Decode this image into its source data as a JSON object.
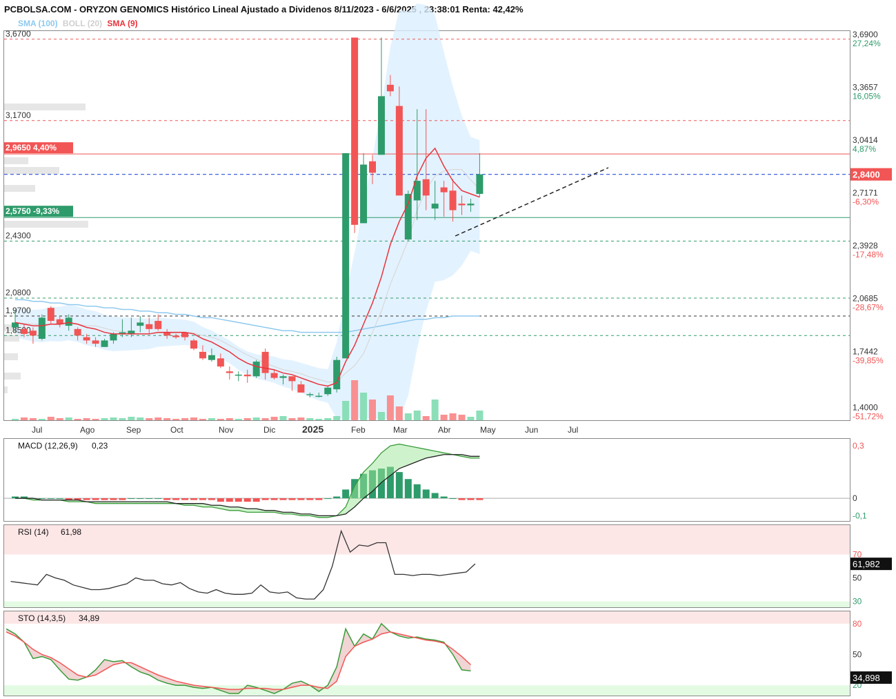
{
  "header": {
    "title": "PCBOLSA.COM - ORYZON GENOMICS Histórico Lineal Ajustado a Dividenos 8/11/2023 - 6/6/2025 , 23:38:01 Renta: 42,42%"
  },
  "legend": {
    "sma100": "SMA (100)",
    "boll": "BOLL (20)",
    "sma9": "SMA (9)"
  },
  "colors": {
    "up": "#2e9b6b",
    "down": "#f25555",
    "sma9": "#e8333b",
    "sma100": "#8ec9ef",
    "boll_fill": "#dcefff",
    "grid": "#888888"
  },
  "price_levels_left": [
    {
      "value": "3,6700",
      "color": "#f25555",
      "dash": true
    },
    {
      "value": "3,1700",
      "color": "#f25555",
      "dash": true
    },
    {
      "value": "2,9650",
      "badge": "2,9650  4,40%",
      "color": "#f25555",
      "dash": false
    },
    {
      "value": "2,5750",
      "badge": "2,5750  -9,33%",
      "color": "#2e9b6b",
      "dash": false
    },
    {
      "value": "2,4300",
      "color": "#2e9b6b",
      "dash": true
    },
    {
      "value": "2,0800",
      "color": "#2e9b6b",
      "dash": true
    },
    {
      "value": "1,9700",
      "color": "#333333",
      "dash": true
    },
    {
      "value": "1,8500",
      "color": "#2e9b6b",
      "dash": true
    }
  ],
  "price_axis_right": [
    {
      "value": "3,6900",
      "pct": "27,24%",
      "pct_color": "#2e9b6b"
    },
    {
      "value": "3,3657",
      "pct": "16,05%",
      "pct_color": "#2e9b6b"
    },
    {
      "value": "3,0414",
      "pct": "4,87%",
      "pct_color": "#2e9b6b"
    },
    {
      "value": "2,7171",
      "pct": "-6,30%",
      "pct_color": "#f25555"
    },
    {
      "value": "2,3928",
      "pct": "-17,48%",
      "pct_color": "#f25555"
    },
    {
      "value": "2,0685",
      "pct": "-28,67%",
      "pct_color": "#f25555"
    },
    {
      "value": "1,7442",
      "pct": "-39,85%",
      "pct_color": "#f25555"
    },
    {
      "value": "1,4000",
      "pct": "-51,72%",
      "pct_color": "#f25555"
    }
  ],
  "last_price": "2,8400",
  "x_labels": [
    "Jul",
    "Ago",
    "Sep",
    "Oct",
    "Nov",
    "Dic",
    "2025",
    "Feb",
    "Mar",
    "Abr",
    "May",
    "Jun",
    "Jul"
  ],
  "chart_data": [
    {
      "type": "candlestick",
      "title": "ORYZON GENOMICS",
      "ylim": [
        1.33,
        3.72
      ],
      "ohlc": [
        [
          1.9,
          2.01,
          1.87,
          1.93
        ],
        [
          1.89,
          1.92,
          1.84,
          1.86
        ],
        [
          1.88,
          1.9,
          1.8,
          1.85
        ],
        [
          1.83,
          1.98,
          1.82,
          1.96
        ],
        [
          2.02,
          2.03,
          1.92,
          1.94
        ],
        [
          1.95,
          1.97,
          1.9,
          1.92
        ],
        [
          1.91,
          1.98,
          1.88,
          1.96
        ],
        [
          1.89,
          1.9,
          1.82,
          1.85
        ],
        [
          1.84,
          1.86,
          1.8,
          1.82
        ],
        [
          1.82,
          1.84,
          1.78,
          1.8
        ],
        [
          1.78,
          1.83,
          1.78,
          1.82
        ],
        [
          1.82,
          1.87,
          1.8,
          1.86
        ],
        [
          1.86,
          1.95,
          1.84,
          1.87
        ],
        [
          1.86,
          1.96,
          1.84,
          1.88
        ],
        [
          1.91,
          1.97,
          1.87,
          1.93
        ],
        [
          1.92,
          1.96,
          1.86,
          1.89
        ],
        [
          1.94,
          1.98,
          1.88,
          1.89
        ],
        [
          1.87,
          1.89,
          1.83,
          1.85
        ],
        [
          1.85,
          1.86,
          1.83,
          1.84
        ],
        [
          1.87,
          1.87,
          1.82,
          1.84
        ],
        [
          1.82,
          1.83,
          1.76,
          1.77
        ],
        [
          1.75,
          1.79,
          1.7,
          1.71
        ],
        [
          1.7,
          1.77,
          1.69,
          1.73
        ],
        [
          1.71,
          1.74,
          1.65,
          1.66
        ],
        [
          1.63,
          1.66,
          1.58,
          1.62
        ],
        [
          1.61,
          1.63,
          1.57,
          1.61
        ],
        [
          1.61,
          1.64,
          1.56,
          1.6
        ],
        [
          1.6,
          1.7,
          1.59,
          1.69
        ],
        [
          1.75,
          1.77,
          1.58,
          1.62
        ],
        [
          1.62,
          1.64,
          1.58,
          1.59
        ],
        [
          1.59,
          1.61,
          1.55,
          1.6
        ],
        [
          1.6,
          1.6,
          1.51,
          1.57
        ],
        [
          1.55,
          1.57,
          1.5,
          1.5
        ],
        [
          1.49,
          1.5,
          1.47,
          1.49
        ],
        [
          1.48,
          1.5,
          1.47,
          1.48
        ],
        [
          1.49,
          1.54,
          1.48,
          1.53
        ],
        [
          1.52,
          1.72,
          1.5,
          1.7
        ],
        [
          1.71,
          2.97,
          1.71,
          2.97
        ],
        [
          3.68,
          3.68,
          2.48,
          2.53
        ],
        [
          2.54,
          2.97,
          2.54,
          2.9
        ],
        [
          2.92,
          2.96,
          2.78,
          2.85
        ],
        [
          2.96,
          3.68,
          2.96,
          3.32
        ],
        [
          3.39,
          3.45,
          3.32,
          3.35
        ],
        [
          3.26,
          3.38,
          2.73,
          2.71
        ],
        [
          2.44,
          2.74,
          2.43,
          2.72
        ],
        [
          2.68,
          3.24,
          2.56,
          2.8
        ],
        [
          2.81,
          3.24,
          2.62,
          2.71
        ],
        [
          2.63,
          2.8,
          2.56,
          2.66
        ],
        [
          2.76,
          2.8,
          2.58,
          2.73
        ],
        [
          2.74,
          2.81,
          2.55,
          2.62
        ],
        [
          2.66,
          2.71,
          2.59,
          2.65
        ],
        [
          2.65,
          2.69,
          2.61,
          2.66
        ],
        [
          2.72,
          2.97,
          2.7,
          2.84
        ]
      ],
      "volume": [
        2,
        4,
        3,
        2,
        5,
        3,
        4,
        2,
        3,
        2,
        3,
        4,
        3,
        5,
        4,
        3,
        4,
        3,
        2,
        3,
        4,
        2,
        3,
        2,
        3,
        2,
        3,
        4,
        3,
        5,
        6,
        3,
        4,
        3,
        2,
        3,
        6,
        28,
        58,
        40,
        30,
        12,
        36,
        20,
        10,
        14,
        6,
        30,
        8,
        10,
        8,
        5,
        14
      ],
      "sma9": [
        1.93,
        1.92,
        1.91,
        1.91,
        1.92,
        1.92,
        1.93,
        1.92,
        1.9,
        1.89,
        1.87,
        1.86,
        1.86,
        1.86,
        1.86,
        1.86,
        1.87,
        1.87,
        1.87,
        1.87,
        1.86,
        1.83,
        1.81,
        1.78,
        1.75,
        1.71,
        1.68,
        1.66,
        1.65,
        1.64,
        1.62,
        1.61,
        1.59,
        1.57,
        1.55,
        1.54,
        1.56,
        1.69,
        1.79,
        1.92,
        2.05,
        2.21,
        2.41,
        2.55,
        2.66,
        2.83,
        2.94,
        3.0,
        2.89,
        2.8,
        2.74,
        2.72,
        2.7
      ],
      "sma100": [
        2.07,
        2.07,
        2.06,
        2.06,
        2.05,
        2.05,
        2.04,
        2.04,
        2.03,
        2.03,
        2.02,
        2.02,
        2.01,
        2.01,
        2.0,
        2.0,
        1.99,
        1.99,
        1.98,
        1.98,
        1.97,
        1.96,
        1.96,
        1.95,
        1.94,
        1.93,
        1.92,
        1.91,
        1.9,
        1.89,
        1.88,
        1.88,
        1.87,
        1.87,
        1.87,
        1.87,
        1.87,
        1.87,
        1.88,
        1.89,
        1.9,
        1.91,
        1.92,
        1.93,
        1.94,
        1.95,
        1.95,
        1.96,
        1.96,
        1.97,
        1.97,
        1.97,
        1.97
      ]
    },
    {
      "type": "line",
      "title": "MACD (12,26,9)",
      "value_label": "0,23",
      "ylim": [
        -0.13,
        0.34
      ],
      "y_ticks": [
        "0,3",
        "0",
        "-0,1"
      ],
      "macd": [
        0,
        0,
        -0.01,
        -0.01,
        -0.01,
        -0.01,
        -0.02,
        -0.02,
        -0.02,
        -0.03,
        -0.03,
        -0.03,
        -0.03,
        -0.03,
        -0.03,
        -0.03,
        -0.03,
        -0.03,
        -0.03,
        -0.04,
        -0.04,
        -0.05,
        -0.05,
        -0.06,
        -0.07,
        -0.07,
        -0.08,
        -0.08,
        -0.08,
        -0.08,
        -0.09,
        -0.09,
        -0.1,
        -0.1,
        -0.11,
        -0.11,
        -0.1,
        -0.05,
        0.07,
        0.15,
        0.2,
        0.26,
        0.3,
        0.31,
        0.3,
        0.29,
        0.28,
        0.27,
        0.26,
        0.25,
        0.24,
        0.23,
        0.23
      ],
      "signal": [
        0,
        0,
        0,
        -0.01,
        -0.01,
        -0.01,
        -0.01,
        -0.01,
        -0.02,
        -0.02,
        -0.02,
        -0.02,
        -0.02,
        -0.02,
        -0.02,
        -0.02,
        -0.02,
        -0.02,
        -0.03,
        -0.03,
        -0.03,
        -0.03,
        -0.04,
        -0.04,
        -0.05,
        -0.05,
        -0.06,
        -0.06,
        -0.07,
        -0.07,
        -0.08,
        -0.08,
        -0.09,
        -0.09,
        -0.1,
        -0.1,
        -0.1,
        -0.09,
        -0.05,
        0.0,
        0.04,
        0.09,
        0.13,
        0.17,
        0.19,
        0.21,
        0.23,
        0.24,
        0.25,
        0.25,
        0.25,
        0.24,
        0.24
      ],
      "histogram": [
        0.01,
        0.01,
        0,
        0,
        0,
        0,
        -0.01,
        -0.01,
        -0.01,
        -0.01,
        -0.01,
        -0.01,
        -0.01,
        0,
        0,
        0,
        0,
        -0.01,
        -0.01,
        -0.01,
        -0.01,
        -0.01,
        -0.01,
        -0.02,
        -0.02,
        -0.02,
        -0.02,
        -0.02,
        -0.01,
        -0.01,
        -0.01,
        -0.01,
        -0.01,
        -0.01,
        -0.01,
        0,
        0.01,
        0.05,
        0.11,
        0.14,
        0.16,
        0.17,
        0.18,
        0.15,
        0.11,
        0.08,
        0.05,
        0.03,
        0.01,
        0,
        -0.01,
        -0.01,
        -0.01
      ]
    },
    {
      "type": "line",
      "title": "RSI (14)",
      "value_label": "61,98",
      "last_value": "61,982",
      "ylim": [
        25,
        95
      ],
      "y_ticks": [
        "70",
        "50",
        "30"
      ],
      "values": [
        47,
        46,
        45,
        44,
        53,
        50,
        48,
        44,
        42,
        40,
        40,
        41,
        43,
        45,
        50,
        48,
        48,
        45,
        44,
        46,
        41,
        38,
        37,
        40,
        37,
        36,
        36,
        37,
        44,
        38,
        37,
        38,
        33,
        32,
        32,
        40,
        60,
        90,
        72,
        78,
        77,
        80,
        80,
        53,
        53,
        52,
        53,
        53,
        52,
        53,
        54,
        55,
        62
      ]
    },
    {
      "type": "line",
      "title": "STO (14,3,5)",
      "value_label": "34,89",
      "last_value": "34,898",
      "ylim": [
        10,
        92
      ],
      "y_ticks": [
        "80",
        "50",
        "20"
      ],
      "k": [
        75,
        70,
        62,
        46,
        48,
        45,
        35,
        26,
        25,
        28,
        35,
        45,
        43,
        44,
        38,
        33,
        30,
        25,
        22,
        20,
        20,
        18,
        17,
        18,
        15,
        12,
        12,
        20,
        18,
        15,
        12,
        16,
        22,
        24,
        20,
        14,
        20,
        38,
        75,
        58,
        70,
        65,
        80,
        72,
        68,
        66,
        67,
        65,
        64,
        62,
        50,
        35,
        34
      ],
      "d": [
        72,
        68,
        62,
        55,
        50,
        47,
        42,
        36,
        30,
        28,
        30,
        35,
        40,
        42,
        42,
        38,
        34,
        30,
        27,
        24,
        22,
        20,
        19,
        18,
        17,
        16,
        16,
        17,
        17,
        17,
        16,
        16,
        18,
        20,
        20,
        18,
        17,
        24,
        48,
        58,
        62,
        65,
        70,
        72,
        70,
        68,
        66,
        64,
        63,
        61,
        55,
        48,
        40
      ]
    }
  ]
}
